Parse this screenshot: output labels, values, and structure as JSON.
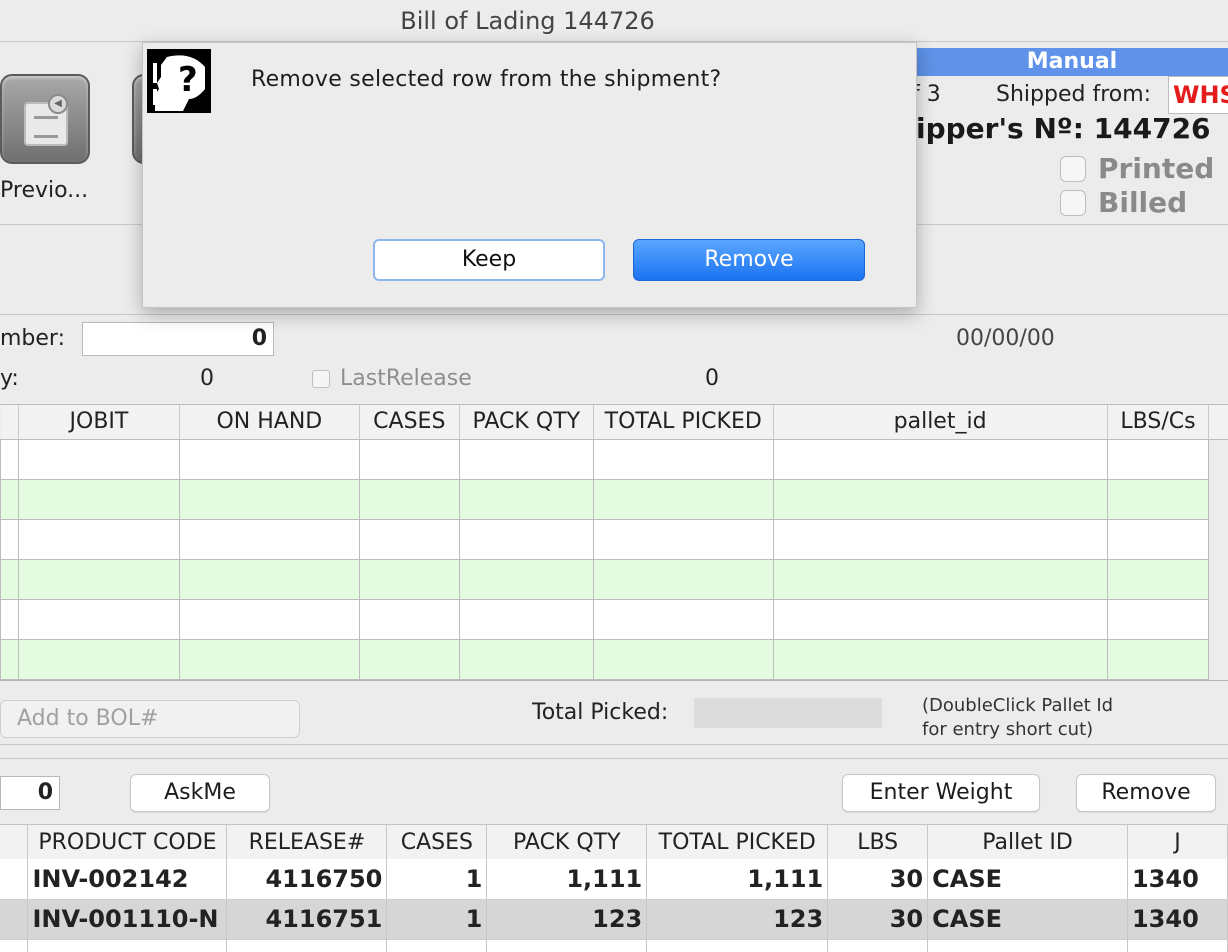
{
  "window": {
    "title": "Bill of Lading 144726"
  },
  "toolbar": {
    "previous_label": "Previo..."
  },
  "header": {
    "mode_badge": "Manual",
    "page_of": "f 3",
    "shipped_from_label": "Shipped from:",
    "shipped_from_value": "WHSE",
    "shipper_no": "ipper's Nº: 144726",
    "printed_label": "Printed",
    "billed_label": "Billed"
  },
  "form": {
    "number_label": "mber:",
    "number_value": "0",
    "date_value": "00/00/00",
    "y_label": "y:",
    "y_value": "0",
    "last_release_label": "LastRelease",
    "last_release_value": "0"
  },
  "pick_grid": {
    "columns": [
      "JOBIT",
      "ON HAND",
      "CASES",
      "PACK QTY",
      "TOTAL PICKED",
      "pallet_id",
      "LBS/Cs"
    ]
  },
  "pick_footer": {
    "add_to_bol_placeholder": "Add to BOL#",
    "total_picked_label": "Total Picked:",
    "hint_line1": "(DoubleClick Pallet Id",
    "hint_line2": "for entry short cut)"
  },
  "shipment_toolbar": {
    "count_value": "0",
    "askme_label": "AskMe",
    "enter_weight_label": "Enter Weight",
    "remove_label": "Remove"
  },
  "shipment_grid": {
    "columns": [
      "PRODUCT CODE",
      "RELEASE#",
      "CASES",
      "PACK QTY",
      "TOTAL PICKED",
      "LBS",
      "Pallet ID",
      "J"
    ],
    "rows": [
      [
        "INV-002142",
        "4116750",
        "1",
        "1,111",
        "1,111",
        "30",
        "CASE",
        "1340"
      ],
      [
        "INV-001110-N",
        "4116751",
        "1",
        "123",
        "123",
        "30",
        "CASE",
        "1340"
      ]
    ]
  },
  "dialog": {
    "message": "Remove selected row from the shipment?",
    "keep_label": "Keep",
    "remove_label": "Remove"
  },
  "colors": {
    "accent_blue": "#5f92e8",
    "row_green": "#e3fbdf",
    "warning_red": "#e51c1c",
    "selected_row": "#d6d6d6"
  }
}
